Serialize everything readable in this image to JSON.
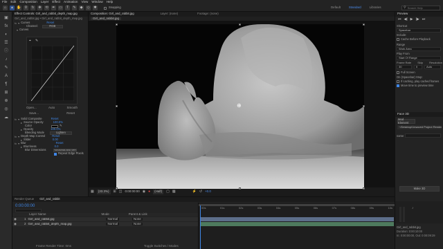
{
  "menu": [
    "File",
    "Edit",
    "Composition",
    "Layer",
    "Effect",
    "Animation",
    "View",
    "Window",
    "Help"
  ],
  "toolbar": {
    "snapping_label": "Snapping",
    "workspaces": [
      "Default",
      "Learn",
      "Standard",
      "Small Screen",
      "Libraries"
    ],
    "active_workspace": "Standard",
    "search_placeholder": "Search Help"
  },
  "effect_controls": {
    "tab_label": "Effect Controls: Girl_and_rabbit_depth_map.jpg",
    "breadcrumb": "Girl_and_rabbit.jpg • Girl_and_rabbit_depth_map.jpg",
    "curves": {
      "label": "Curves",
      "reset": "Reset",
      "channel_label": "Channel:",
      "channel_value": "RGB",
      "sub_label": "Curves",
      "buttons": [
        "Open...",
        "Auto",
        "Smooth",
        "Save...",
        "Reset"
      ]
    },
    "solid_composite": {
      "label": "Solid Composite",
      "reset": "Reset",
      "source_opacity_label": "Source Opacity",
      "source_opacity_value": "100.0%",
      "color_label": "Color",
      "opacity_label": "Opacity",
      "opacity_value": "100.0%",
      "blending_mode_label": "Blending Mode",
      "blending_mode_value": "Lighten"
    },
    "depth_map_control": {
      "label": "Depth Map Control",
      "reset": "Reset",
      "slider_label": "Slider",
      "slider_value": "0.00"
    },
    "blur": {
      "label": "Blur",
      "reset": "Reset",
      "blurriness_label": "Blurriness",
      "blurriness_value": "0.0",
      "dimensions_label": "Blur Dimensions",
      "dimensions_value": "Horizontal and Vert",
      "repeat_edge_label": "Repeat Edge Pixels"
    }
  },
  "composition": {
    "tab_label": "Composition: Girl_and_rabbit.jpg",
    "subtab": "Girl_and_rabbit.jpg",
    "other_tabs": [
      "Layer: (none)",
      "Footage: (none)"
    ],
    "zoom": "(33.3%)",
    "quality": "(Half)",
    "timecode": "0:00:00:00",
    "timecode_right": "+0.0"
  },
  "timeline": {
    "tabs": [
      "Render Queue",
      "Girl_and_rabbit"
    ],
    "active_tab": "Girl_and_rabbit",
    "timecode": "0:00:00:00",
    "layer_header": "Layer Name",
    "mode_header": "Mode",
    "parent_header": "Parent & Link",
    "ruler": [
      "00s",
      "01s",
      "02s",
      "03s",
      "04s",
      "05s",
      "06s",
      "07s",
      "08s",
      "09s",
      "10s"
    ],
    "layers": [
      {
        "num": "1",
        "name": "Girl_and_rabbit.jpg",
        "mode": "Normal",
        "parent": "None"
      },
      {
        "num": "2",
        "name": "Girl_and_rabbit_depth_map.jpg",
        "mode": "Normal",
        "parent": "None"
      }
    ],
    "render_time_label": "Frame Render Time: 0ms",
    "toggle_label": "Toggle Switches / Modes"
  },
  "preview": {
    "title": "Preview",
    "shortcut_label": "Shortcut",
    "shortcut_value": "Spacebar",
    "include_label": "Include:",
    "cache_label": "Cache Before Playback",
    "range_label": "Range",
    "range_value": "Work Area",
    "play_from_label": "Play From",
    "play_from_value": "Start Of Range",
    "frame_rate_label": "Frame Rate",
    "skip_label": "Skip",
    "resolution_label": "Resolution",
    "frame_rate_value": "30",
    "skip_value": "0",
    "resolution_value": "Auto",
    "fullscreen_label": "Full Screen",
    "stop_label": "On (Spacebar) Stop:",
    "if_caching_label": "If caching, play cached frames",
    "move_time_label": "Move time to preview time"
  },
  "face3d": {
    "title": "Face 3D",
    "button": "Mod Element",
    "preset": "~/Desktop/Unsaved Project Rendere",
    "name_label": "name",
    "make_button": "Make 3D"
  },
  "footer_info": {
    "name": "Girl_and_rabbit.jpg",
    "duration": "Duration: 0:00:10:00",
    "in_out": "In: 0:00:00:00, Out: 0:00:09:29"
  }
}
